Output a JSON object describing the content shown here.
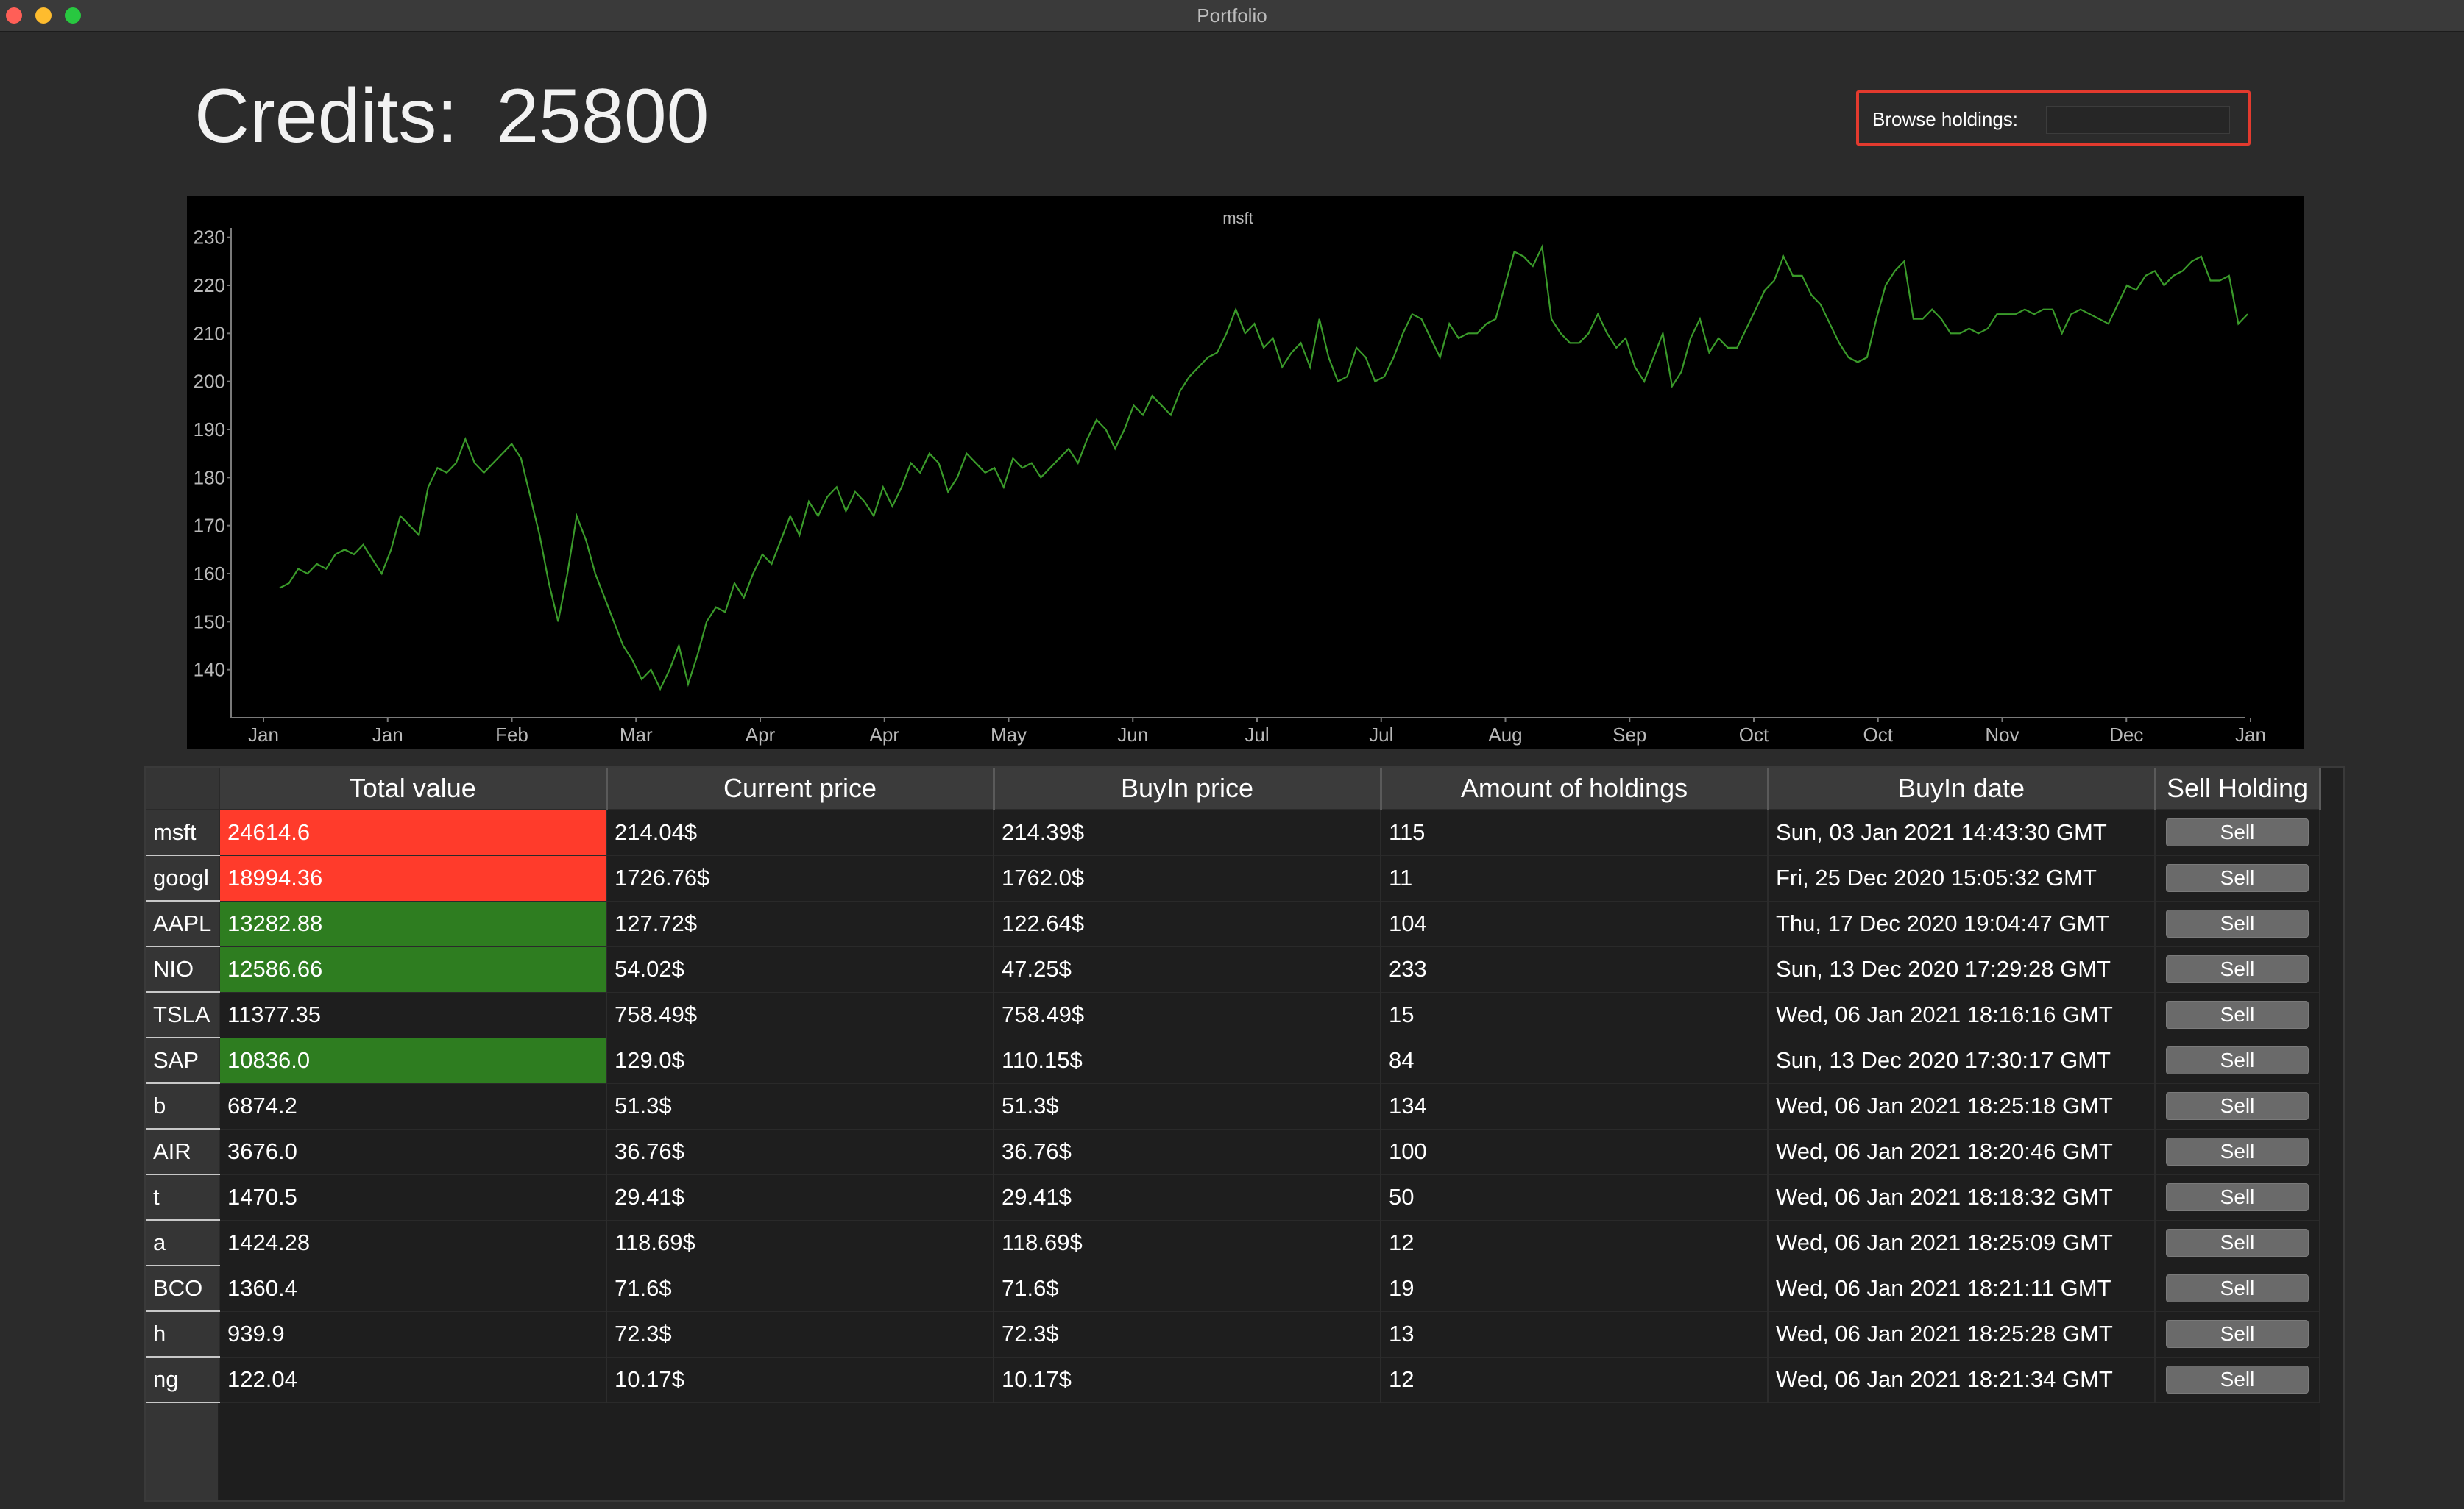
{
  "window": {
    "title": "Portfolio"
  },
  "credits": {
    "label": "Credits:",
    "value": "25800"
  },
  "browse": {
    "label": "Browse holdings:",
    "value": ""
  },
  "chart_data": {
    "type": "line",
    "title": "msft",
    "xlabel": "",
    "ylabel": "",
    "ylim": [
      130,
      235
    ],
    "yticks": [
      140,
      150,
      160,
      170,
      180,
      190,
      200,
      210,
      220,
      230
    ],
    "xticks": [
      "Jan",
      "Jan",
      "Feb",
      "Mar",
      "Apr",
      "Apr",
      "May",
      "Jun",
      "Jul",
      "Jul",
      "Aug",
      "Sep",
      "Oct",
      "Oct",
      "Nov",
      "Dec",
      "Jan"
    ],
    "line_color": "#3a9a2a",
    "grid": false,
    "series": [
      {
        "values": [
          157,
          158,
          161,
          160,
          162,
          161,
          164,
          165,
          164,
          166,
          163,
          160,
          165,
          172,
          170,
          168,
          178,
          182,
          181,
          183,
          188,
          183,
          181,
          183,
          185,
          187,
          184,
          176,
          168,
          158,
          150,
          160,
          172,
          167,
          160,
          155,
          150,
          145,
          142,
          138,
          140,
          136,
          140,
          145,
          137,
          143,
          150,
          153,
          152,
          158,
          155,
          160,
          164,
          162,
          167,
          172,
          168,
          175,
          172,
          176,
          178,
          173,
          177,
          175,
          172,
          178,
          174,
          178,
          183,
          181,
          185,
          183,
          177,
          180,
          185,
          183,
          181,
          182,
          178,
          184,
          182,
          183,
          180,
          182,
          184,
          186,
          183,
          188,
          192,
          190,
          186,
          190,
          195,
          193,
          197,
          195,
          193,
          198,
          201,
          203,
          205,
          206,
          210,
          215,
          210,
          212,
          207,
          209,
          203,
          206,
          208,
          203,
          213,
          205,
          200,
          201,
          207,
          205,
          200,
          201,
          205,
          210,
          214,
          213,
          209,
          205,
          212,
          209,
          210,
          210,
          212,
          213,
          220,
          227,
          226,
          224,
          228,
          213,
          210,
          208,
          208,
          210,
          214,
          210,
          207,
          209,
          203,
          200,
          205,
          210,
          199,
          202,
          209,
          213,
          206,
          209,
          207,
          207,
          211,
          215,
          219,
          221,
          226,
          222,
          222,
          218,
          216,
          212,
          208,
          205,
          204,
          205,
          213,
          220,
          223,
          225,
          213,
          213,
          215,
          213,
          210,
          210,
          211,
          210,
          211,
          214,
          214,
          214,
          215,
          214,
          215,
          215,
          210,
          214,
          215,
          214,
          213,
          212,
          216,
          220,
          219,
          222,
          223,
          220,
          222,
          223,
          225,
          226,
          221,
          221,
          222,
          212,
          214
        ]
      }
    ]
  },
  "table": {
    "columns": [
      "Total value",
      "Current price",
      "BuyIn price",
      "Amount of holdings",
      "BuyIn date",
      "Sell Holding"
    ],
    "rows": [
      {
        "symbol": "msft",
        "total": "24614.6",
        "status": "neg",
        "current": "214.04$",
        "buyin": "214.39$",
        "amount": "115",
        "date": "Sun, 03 Jan 2021 14:43:30 GMT",
        "sell": "Sell"
      },
      {
        "symbol": "googl",
        "total": "18994.36",
        "status": "neg",
        "current": "1726.76$",
        "buyin": "1762.0$",
        "amount": "11",
        "date": "Fri, 25 Dec 2020 15:05:32 GMT",
        "sell": "Sell"
      },
      {
        "symbol": "AAPL",
        "total": "13282.88",
        "status": "pos",
        "current": "127.72$",
        "buyin": "122.64$",
        "amount": "104",
        "date": "Thu, 17 Dec 2020 19:04:47 GMT",
        "sell": "Sell"
      },
      {
        "symbol": "NIO",
        "total": "12586.66",
        "status": "pos",
        "current": "54.02$",
        "buyin": "47.25$",
        "amount": "233",
        "date": "Sun, 13 Dec 2020 17:29:28 GMT",
        "sell": "Sell"
      },
      {
        "symbol": "TSLA",
        "total": "11377.35",
        "status": "none",
        "current": "758.49$",
        "buyin": "758.49$",
        "amount": "15",
        "date": "Wed, 06 Jan 2021 18:16:16 GMT",
        "sell": "Sell"
      },
      {
        "symbol": "SAP",
        "total": "10836.0",
        "status": "pos",
        "current": "129.0$",
        "buyin": "110.15$",
        "amount": "84",
        "date": "Sun, 13 Dec 2020 17:30:17 GMT",
        "sell": "Sell"
      },
      {
        "symbol": "b",
        "total": "6874.2",
        "status": "none",
        "current": "51.3$",
        "buyin": "51.3$",
        "amount": "134",
        "date": "Wed, 06 Jan 2021 18:25:18 GMT",
        "sell": "Sell"
      },
      {
        "symbol": "AIR",
        "total": "3676.0",
        "status": "none",
        "current": "36.76$",
        "buyin": "36.76$",
        "amount": "100",
        "date": "Wed, 06 Jan 2021 18:20:46 GMT",
        "sell": "Sell"
      },
      {
        "symbol": "t",
        "total": "1470.5",
        "status": "none",
        "current": "29.41$",
        "buyin": "29.41$",
        "amount": "50",
        "date": "Wed, 06 Jan 2021 18:18:32 GMT",
        "sell": "Sell"
      },
      {
        "symbol": "a",
        "total": "1424.28",
        "status": "none",
        "current": "118.69$",
        "buyin": "118.69$",
        "amount": "12",
        "date": "Wed, 06 Jan 2021 18:25:09 GMT",
        "sell": "Sell"
      },
      {
        "symbol": "BCO",
        "total": "1360.4",
        "status": "none",
        "current": "71.6$",
        "buyin": "71.6$",
        "amount": "19",
        "date": "Wed, 06 Jan 2021 18:21:11 GMT",
        "sell": "Sell"
      },
      {
        "symbol": "h",
        "total": "939.9",
        "status": "none",
        "current": "72.3$",
        "buyin": "72.3$",
        "amount": "13",
        "date": "Wed, 06 Jan 2021 18:25:28 GMT",
        "sell": "Sell"
      },
      {
        "symbol": "ng",
        "total": "122.04",
        "status": "none",
        "current": "10.17$",
        "buyin": "10.17$",
        "amount": "12",
        "date": "Wed, 06 Jan 2021 18:21:34 GMT",
        "sell": "Sell"
      }
    ]
  }
}
